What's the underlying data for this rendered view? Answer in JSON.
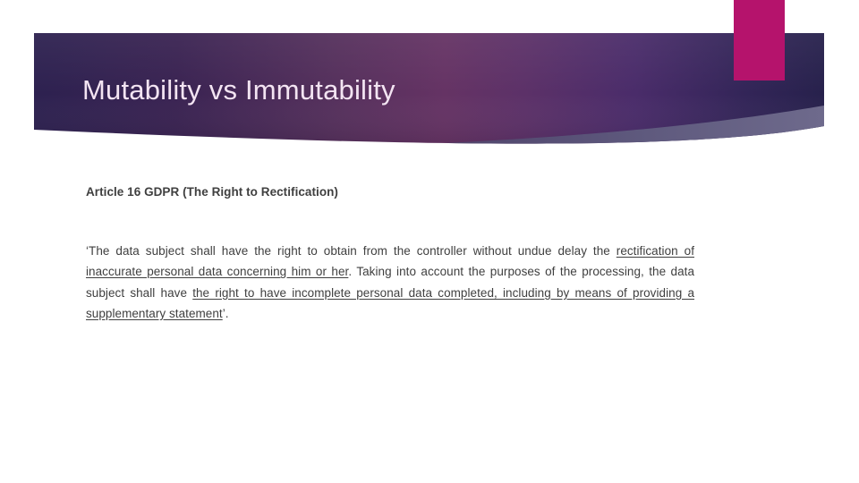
{
  "slide": {
    "title": "Mutability vs Immutability",
    "heading": "Article 16 GDPR (The Right to Rectification)",
    "paragraph": {
      "part1": "‘The data subject shall have the right to obtain from the controller without undue delay the ",
      "underline1": "rectification of inaccurate personal data concerning him or her",
      "part2": ". Taking into account the purposes of the processing, the data subject shall have ",
      "underline2": "the right to have incomplete personal data completed, including by means of providing a supplementary statement",
      "part3": "’."
    },
    "paragraph_full": "‘The data subject shall have the right to obtain from the controller without undue delay the rectification of inaccurate personal data concerning him or her. Taking into account the purposes of the processing, the data subject shall have the right to have incomplete personal data completed, including by means of providing a supplementary statement’."
  },
  "decor": {
    "pink_accent_name": "pink-accent-bar",
    "banner_name": "header-banner-shape"
  },
  "colors": {
    "banner_dark_left": "#2d2150",
    "banner_mid_plum": "#633263",
    "banner_violet": "#4a2c6a",
    "banner_dark_right": "#27214c",
    "pink_accent": "#b5136c",
    "swoosh_gray": "#5f5a7e",
    "title_text": "#f3e4f2",
    "body_text": "#3f3f3f",
    "background": "#ffffff"
  }
}
